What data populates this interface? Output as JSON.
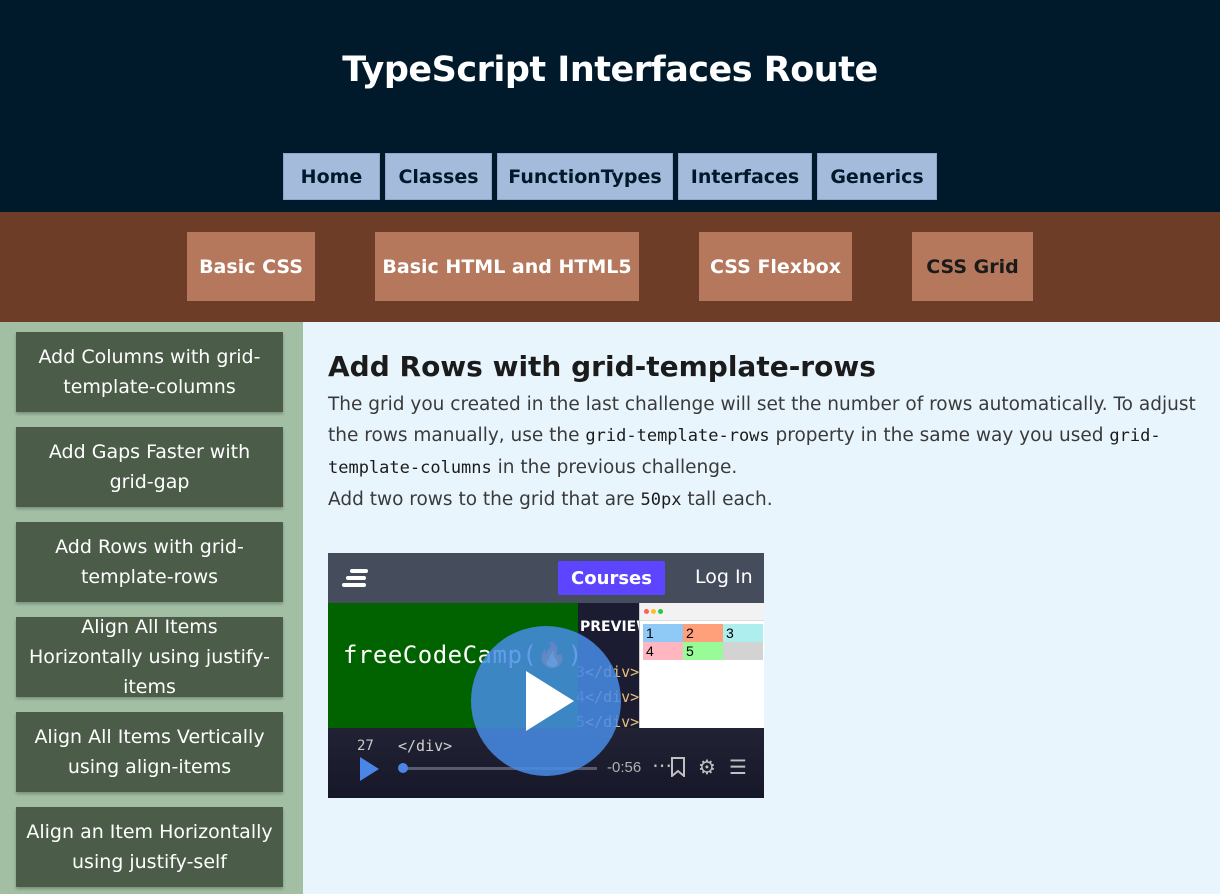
{
  "header": {
    "title": "TypeScript Interfaces Route",
    "nav": [
      "Home",
      "Classes",
      "FunctionTypes",
      "Interfaces",
      "Generics"
    ]
  },
  "topics": {
    "items": [
      "Basic CSS",
      "Basic HTML and HTML5",
      "CSS Flexbox",
      "CSS Grid"
    ],
    "active": "CSS Grid"
  },
  "sidebar": {
    "items": [
      "Add Columns with grid-template-columns",
      "Add Gaps Faster with grid-gap",
      "Add Rows with grid-template-rows",
      "Align All Items Horizontally using justify-items",
      "Align All Items Vertically using align-items",
      "Align an Item Horizontally using justify-self"
    ]
  },
  "lesson": {
    "title": "Add Rows with grid-template-rows",
    "p1_a": "The grid you created in the last challenge will set the number of rows automatically. To adjust the rows manually, use the ",
    "p1_code1": "grid-template-rows",
    "p1_b": " property in the same way you used ",
    "p1_code2": "grid-template-columns",
    "p1_c": " in the previous challenge.",
    "p2_a": "Add two rows to the grid that are ",
    "p2_code": "50px",
    "p2_b": " tall each."
  },
  "video": {
    "courses_label": "Courses",
    "login_label": "Log In",
    "wordmark": "freeCodeCamp(🔥)",
    "preview_label": "PREVIEW",
    "code_line_number": "27",
    "code_closing_tag": "</div>",
    "time_remaining": "-0:56",
    "grid_cells": [
      "1",
      "2",
      "3",
      "4",
      "5"
    ],
    "colors": {
      "courses": "#5d45ff",
      "play": "#4b86e6",
      "panel": "#006300"
    }
  },
  "colors": {
    "header_bg": "#001a2c",
    "nav_btn": "#a5bbdb",
    "topic_bar": "#6e3d27",
    "topic_btn": "#b5785d",
    "sidebar_bg": "#a2bfa4",
    "sidebar_item": "#4b5d49",
    "content_bg": "#e8f5fd"
  }
}
